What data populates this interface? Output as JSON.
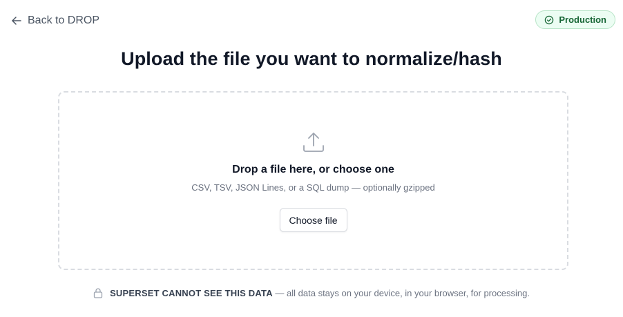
{
  "header": {
    "back_label": "Back to DROP",
    "environment_badge": "Production"
  },
  "main": {
    "title": "Upload the file you want to normalize/hash",
    "drop_zone": {
      "icon": "upload-icon",
      "heading": "Drop a file here, or choose one",
      "hint": "CSV, TSV, JSON Lines, or a SQL dump — optionally gzipped",
      "button_label": "Choose file"
    }
  },
  "privacy": {
    "icon": "lock-icon",
    "strong_text": "SUPERSET CANNOT SEE THIS DATA",
    "rest_text": "— all data stays on your device, in your browser, for processing."
  },
  "colors": {
    "badge_background": "#ecfdf3",
    "badge_text": "#166534",
    "badge_border": "#b7e4c7",
    "dashed_border": "#d9dce1",
    "title_text": "#111827",
    "muted_text": "#6b7280"
  }
}
